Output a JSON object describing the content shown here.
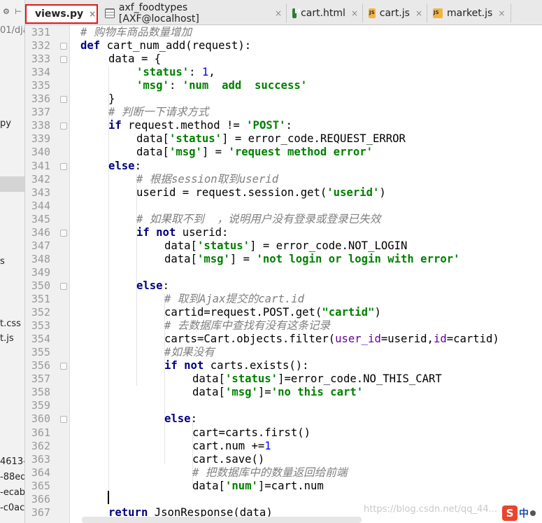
{
  "left_panel": {
    "toolbar_glyphs": "⚙ ⊢",
    "items": [
      {
        "text": "01/dja",
        "dim": true
      },
      {
        "text": "py",
        "dim": false
      },
      {
        "text": "s",
        "dim": false
      },
      {
        "text": "t.css",
        "dim": false
      },
      {
        "text": "t.js",
        "dim": false
      },
      {
        "text": "4613-",
        "dim": false
      },
      {
        "text": "-88ed",
        "dim": false
      },
      {
        "text": "-ecab",
        "dim": false
      },
      {
        "text": "-c0ac",
        "dim": false
      }
    ]
  },
  "tabs": [
    {
      "label": "views.py",
      "icon": "python-file-icon",
      "active": true,
      "close": "×"
    },
    {
      "label": "axf_foodtypes [AXF@localhost]",
      "icon": "table-icon",
      "active": false,
      "close": "×"
    },
    {
      "label": "cart.html",
      "icon": "html-file-icon",
      "active": false,
      "close": "×"
    },
    {
      "label": "cart.js",
      "icon": "js-file-icon",
      "active": false,
      "close": "×"
    },
    {
      "label": "market.js",
      "icon": "js-file-icon",
      "active": false,
      "close": "×"
    }
  ],
  "editor": {
    "current_line": 366,
    "lines": [
      {
        "n": "331",
        "indent": 0,
        "tokens": [
          [
            "cm",
            "# 购物车商品数量增加"
          ]
        ]
      },
      {
        "n": "332",
        "indent": 0,
        "tokens": [
          [
            "kw",
            "def "
          ],
          [
            "fn",
            "cart_num_add(request):"
          ]
        ]
      },
      {
        "n": "333",
        "indent": 1,
        "tokens": [
          [
            "fn",
            "data = {"
          ]
        ]
      },
      {
        "n": "334",
        "indent": 2,
        "tokens": [
          [
            "str",
            "'status'"
          ],
          [
            "fn",
            ": "
          ],
          [
            "num",
            "1"
          ],
          [
            "fn",
            ","
          ]
        ]
      },
      {
        "n": "335",
        "indent": 2,
        "tokens": [
          [
            "str",
            "'msg'"
          ],
          [
            "fn",
            ": "
          ],
          [
            "str",
            "'num  add  success'"
          ]
        ]
      },
      {
        "n": "336",
        "indent": 1,
        "tokens": [
          [
            "fn",
            "}"
          ]
        ]
      },
      {
        "n": "337",
        "indent": 1,
        "tokens": [
          [
            "cm",
            "# 判断一下请求方式"
          ]
        ]
      },
      {
        "n": "338",
        "indent": 1,
        "tokens": [
          [
            "kw",
            "if "
          ],
          [
            "fn",
            "request.method != "
          ],
          [
            "str",
            "'POST'"
          ],
          [
            "fn",
            ":"
          ]
        ]
      },
      {
        "n": "339",
        "indent": 2,
        "tokens": [
          [
            "fn",
            "data["
          ],
          [
            "str",
            "'status'"
          ],
          [
            "fn",
            "] = error_code.REQUEST_ERROR"
          ]
        ]
      },
      {
        "n": "340",
        "indent": 2,
        "tokens": [
          [
            "fn",
            "data["
          ],
          [
            "str",
            "'msg'"
          ],
          [
            "fn",
            "] = "
          ],
          [
            "str",
            "'request method error'"
          ]
        ]
      },
      {
        "n": "341",
        "indent": 1,
        "tokens": [
          [
            "kw",
            "else"
          ],
          [
            "fn",
            ":"
          ]
        ]
      },
      {
        "n": "342",
        "indent": 2,
        "tokens": [
          [
            "cm",
            "# 根据session取到userid"
          ]
        ]
      },
      {
        "n": "343",
        "indent": 2,
        "tokens": [
          [
            "fn",
            "userid = request.session.get("
          ],
          [
            "str",
            "'userid'"
          ],
          [
            "fn",
            ")"
          ]
        ]
      },
      {
        "n": "344",
        "indent": 0,
        "tokens": []
      },
      {
        "n": "345",
        "indent": 2,
        "tokens": [
          [
            "cm",
            "# 如果取不到  ，说明用户没有登录或登录已失效"
          ]
        ]
      },
      {
        "n": "346",
        "indent": 2,
        "tokens": [
          [
            "kw",
            "if not "
          ],
          [
            "fn",
            "userid:"
          ]
        ]
      },
      {
        "n": "347",
        "indent": 3,
        "tokens": [
          [
            "fn",
            "data["
          ],
          [
            "str",
            "'status'"
          ],
          [
            "fn",
            "] = error_code.NOT_LOGIN"
          ]
        ]
      },
      {
        "n": "348",
        "indent": 3,
        "tokens": [
          [
            "fn",
            "data["
          ],
          [
            "str",
            "'msg'"
          ],
          [
            "fn",
            "] = "
          ],
          [
            "str",
            "'not login or login with error'"
          ]
        ]
      },
      {
        "n": "349",
        "indent": 0,
        "tokens": []
      },
      {
        "n": "350",
        "indent": 2,
        "tokens": [
          [
            "kw",
            "else"
          ],
          [
            "fn",
            ":"
          ]
        ]
      },
      {
        "n": "351",
        "indent": 3,
        "tokens": [
          [
            "cm",
            "# 取到Ajax提交的cart.id"
          ]
        ]
      },
      {
        "n": "352",
        "indent": 3,
        "tokens": [
          [
            "fn",
            "cartid=request.POST.get("
          ],
          [
            "str",
            "\"cartid\""
          ],
          [
            "fn",
            ")"
          ]
        ]
      },
      {
        "n": "353",
        "indent": 3,
        "tokens": [
          [
            "cm",
            "# 去数据库中查找有没有这条记录"
          ]
        ]
      },
      {
        "n": "354",
        "indent": 3,
        "tokens": [
          [
            "fn",
            "carts=Cart.objects.filter("
          ],
          [
            "prm",
            "user_id"
          ],
          [
            "fn",
            "=userid,"
          ],
          [
            "prm",
            "id"
          ],
          [
            "fn",
            "=cartid)"
          ]
        ]
      },
      {
        "n": "355",
        "indent": 3,
        "tokens": [
          [
            "cm",
            "#如果没有"
          ]
        ]
      },
      {
        "n": "356",
        "indent": 3,
        "tokens": [
          [
            "kw",
            "if not "
          ],
          [
            "fn",
            "carts.exists():"
          ]
        ]
      },
      {
        "n": "357",
        "indent": 4,
        "tokens": [
          [
            "fn",
            "data["
          ],
          [
            "str",
            "'status'"
          ],
          [
            "fn",
            "]=error_code.NO_THIS_CART"
          ]
        ]
      },
      {
        "n": "358",
        "indent": 4,
        "tokens": [
          [
            "fn",
            "data["
          ],
          [
            "str",
            "'msg'"
          ],
          [
            "fn",
            "]="
          ],
          [
            "str",
            "'no this cart'"
          ]
        ]
      },
      {
        "n": "359",
        "indent": 0,
        "tokens": []
      },
      {
        "n": "360",
        "indent": 3,
        "tokens": [
          [
            "kw",
            "else"
          ],
          [
            "fn",
            ":"
          ]
        ]
      },
      {
        "n": "361",
        "indent": 4,
        "tokens": [
          [
            "fn",
            "cart=carts.first()"
          ]
        ]
      },
      {
        "n": "362",
        "indent": 4,
        "tokens": [
          [
            "fn",
            "cart.num +="
          ],
          [
            "num",
            "1"
          ]
        ]
      },
      {
        "n": "363",
        "indent": 4,
        "tokens": [
          [
            "fn",
            "cart.save()"
          ]
        ]
      },
      {
        "n": "364",
        "indent": 4,
        "tokens": [
          [
            "cm",
            "# 把数据库中的数量返回给前端"
          ]
        ]
      },
      {
        "n": "365",
        "indent": 4,
        "tokens": [
          [
            "fn",
            "data["
          ],
          [
            "str",
            "'num'"
          ],
          [
            "fn",
            "]=cart.num"
          ]
        ]
      },
      {
        "n": "366",
        "indent": 0,
        "tokens": []
      },
      {
        "n": "367",
        "indent": 1,
        "tokens": [
          [
            "kw",
            "return "
          ],
          [
            "fn",
            "JsonResponse(data)"
          ]
        ]
      }
    ]
  },
  "watermark": "https://blog.csdn.net/qq_44...",
  "ime": {
    "brand": "S",
    "lang": "中"
  }
}
